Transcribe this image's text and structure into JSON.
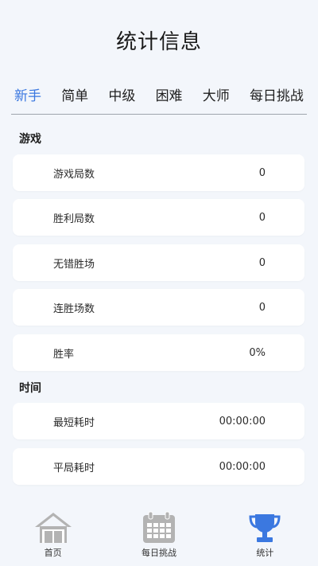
{
  "header": {
    "title": "统计信息"
  },
  "tabs": [
    {
      "label": "新手",
      "active": true
    },
    {
      "label": "简单",
      "active": false
    },
    {
      "label": "中级",
      "active": false
    },
    {
      "label": "困难",
      "active": false
    },
    {
      "label": "大师",
      "active": false
    },
    {
      "label": "每日挑战",
      "active": false
    }
  ],
  "sections": {
    "game": {
      "label": "游戏",
      "rows": [
        {
          "label": "游戏局数",
          "value": "0"
        },
        {
          "label": "胜利局数",
          "value": "0"
        },
        {
          "label": "无错胜场",
          "value": "0"
        },
        {
          "label": "连胜场数",
          "value": "0"
        },
        {
          "label": "胜率",
          "value": "0%"
        }
      ]
    },
    "time": {
      "label": "时间",
      "rows": [
        {
          "label": "最短耗时",
          "value": "00:00:00"
        },
        {
          "label": "平局耗时",
          "value": "00:00:00"
        }
      ]
    }
  },
  "bottom_nav": [
    {
      "label": "首页",
      "icon": "home-icon",
      "active": false
    },
    {
      "label": "每日挑战",
      "icon": "calendar-icon",
      "active": false
    },
    {
      "label": "统计",
      "icon": "trophy-icon",
      "active": true
    }
  ],
  "colors": {
    "accent": "#3b78e0",
    "inactive_icon": "#b3b3b3",
    "background": "#f3f6fb",
    "card": "#ffffff"
  }
}
